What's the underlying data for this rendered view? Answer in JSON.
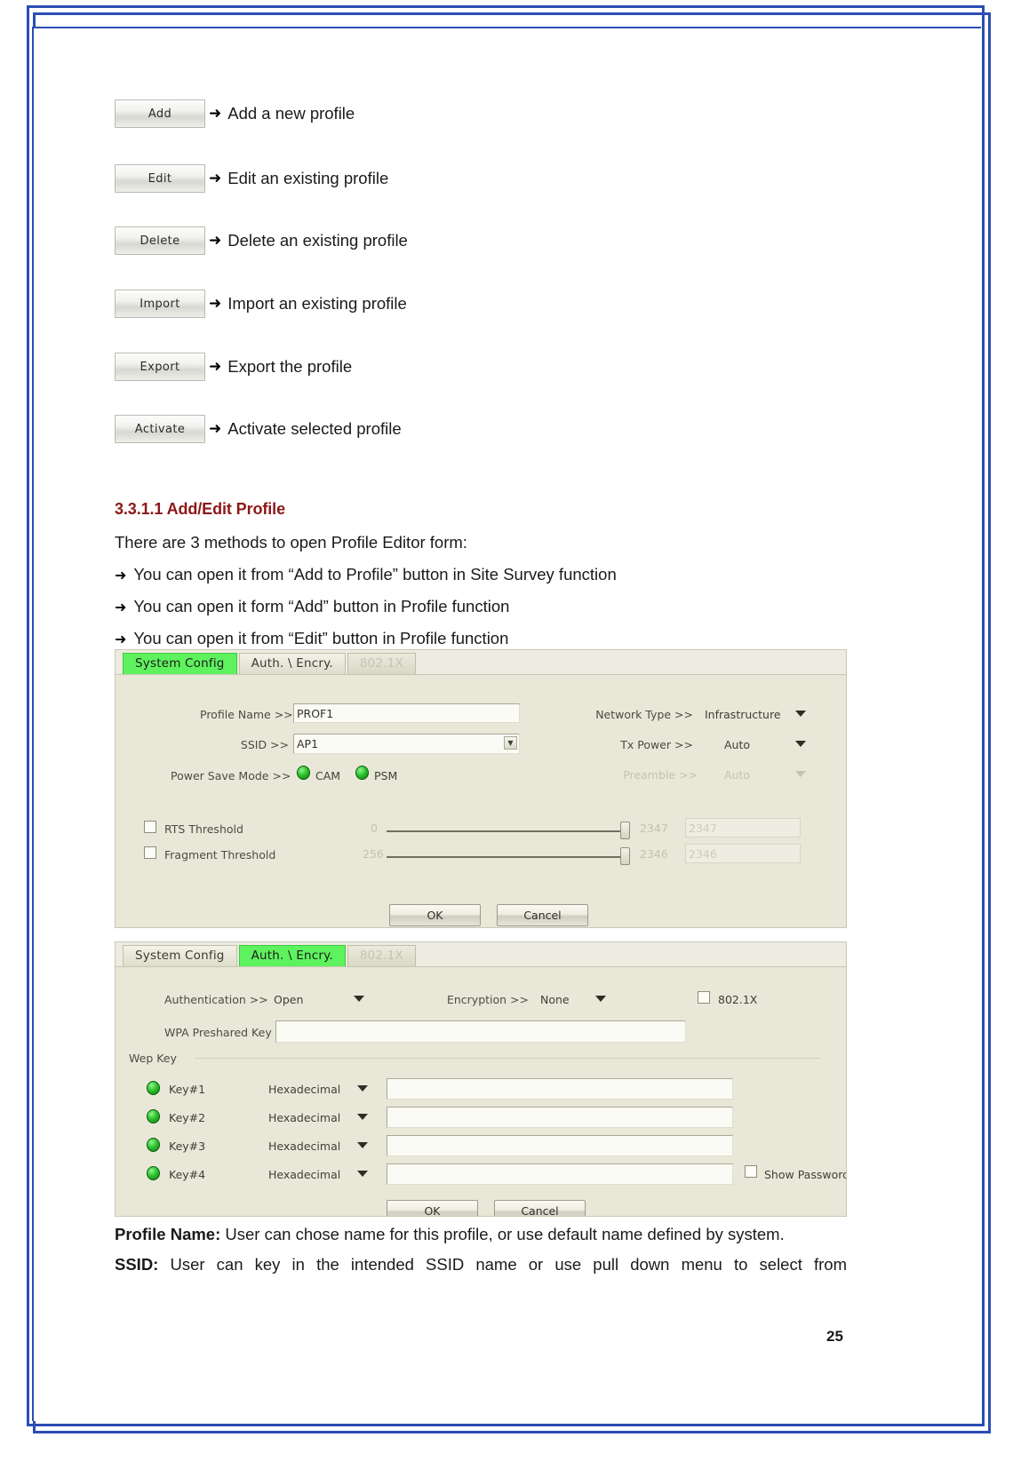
{
  "page": {
    "number": "25"
  },
  "button_list": [
    {
      "button_label": "Add",
      "arrow": "➜",
      "description": "Add a new profile"
    },
    {
      "button_label": "Edit",
      "arrow": "➜",
      "description": "Edit an existing profile"
    },
    {
      "button_label": "Delete",
      "arrow": "➜",
      "description": "Delete an existing profile"
    },
    {
      "button_label": "Import",
      "arrow": "➜",
      "description": "Import an existing profile"
    },
    {
      "button_label": "Export",
      "arrow": "➜",
      "description": "Export the profile"
    },
    {
      "button_label": "Activate",
      "arrow": "➜",
      "description": "Activate selected profile"
    }
  ],
  "section": {
    "heading": "3.3.1.1 Add/Edit Profile",
    "intro": "There are 3 methods to open Profile Editor form:",
    "bullets": [
      {
        "arrow": "➜",
        "text": "You can open it from “Add to Profile” button in Site Survey function"
      },
      {
        "arrow": "➜",
        "text": "You can open it form “Add” button in Profile function"
      },
      {
        "arrow": "➜",
        "text": "You can open it from “Edit” button in Profile function"
      }
    ]
  },
  "panel_system_config": {
    "tabs": [
      {
        "label": "System Config",
        "state": "active"
      },
      {
        "label": "Auth. \\ Encry.",
        "state": "normal"
      },
      {
        "label": "802.1X",
        "state": "disabled"
      }
    ],
    "fields": {
      "profile_name_label": "Profile Name >>",
      "profile_name_value": "PROF1",
      "ssid_label": "SSID >>",
      "ssid_value": "AP1",
      "power_save_label": "Power Save Mode >>",
      "power_save_option_cam": "CAM",
      "power_save_option_psm": "PSM",
      "network_type_label": "Network Type >>",
      "network_type_value": "Infrastructure",
      "tx_power_label": "Tx Power >>",
      "tx_power_value": "Auto",
      "preamble_label": "Preamble >>",
      "preamble_value": "Auto",
      "rts_threshold_label": "RTS Threshold",
      "rts_min": "0",
      "rts_max": "2347",
      "rts_value": "2347",
      "frag_threshold_label": "Fragment Threshold",
      "frag_min": "256",
      "frag_max": "2346",
      "frag_value": "2346"
    },
    "ok_label": "OK",
    "cancel_label": "Cancel"
  },
  "panel_auth_encry": {
    "tabs": [
      {
        "label": "System Config",
        "state": "normal"
      },
      {
        "label": "Auth. \\ Encry.",
        "state": "active"
      },
      {
        "label": "802.1X",
        "state": "disabled"
      }
    ],
    "fields": {
      "authentication_label": "Authentication >>",
      "authentication_value": "Open",
      "encryption_label": "Encryption >>",
      "encryption_value": "None",
      "dot1x_label": "802.1X",
      "wpa_key_label": "WPA Preshared Key >>",
      "wpa_key_value": "",
      "wep_key_group_label": "Wep Key",
      "show_password_label": "Show Password"
    },
    "wep_keys": [
      {
        "name": "Key#1",
        "format": "Hexadecimal",
        "value": ""
      },
      {
        "name": "Key#2",
        "format": "Hexadecimal",
        "value": ""
      },
      {
        "name": "Key#3",
        "format": "Hexadecimal",
        "value": ""
      },
      {
        "name": "Key#4",
        "format": "Hexadecimal",
        "value": ""
      }
    ],
    "ok_label": "OK",
    "cancel_label": "Cancel"
  },
  "body_paragraphs": [
    {
      "lead": "Profile Name:",
      "text": " User can chose name for this profile, or use default name defined by system."
    },
    {
      "lead": "SSID:",
      "text": " User can key in the intended SSID name or use pull down menu to select from"
    }
  ],
  "colors": {
    "heading_red": "#8c1818",
    "frame_blue": "#2b4db3",
    "tab_active_green": "#5ef25e",
    "panel_bg": "#e9e8d8"
  }
}
